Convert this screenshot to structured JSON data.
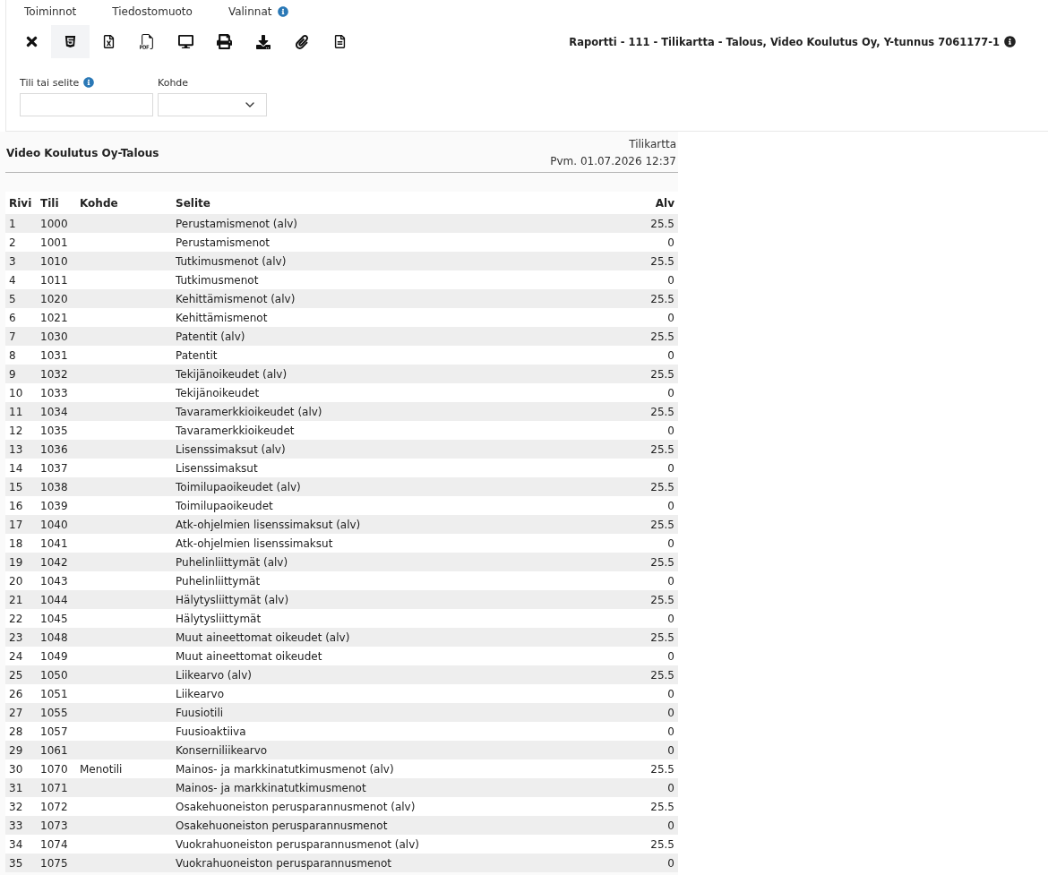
{
  "menu": [
    {
      "label": "Toiminnot",
      "info": false
    },
    {
      "label": "Tiedostomuoto",
      "info": false
    },
    {
      "label": "Valinnat",
      "info": true
    }
  ],
  "toolbar": {
    "buttons": [
      {
        "kind": "close",
        "selected": false
      },
      {
        "kind": "html",
        "selected": true
      },
      {
        "kind": "excel",
        "selected": false
      },
      {
        "kind": "pdf",
        "selected": false
      },
      {
        "kind": "screen",
        "selected": false
      },
      {
        "kind": "print",
        "selected": false
      },
      {
        "kind": "download",
        "selected": false
      },
      {
        "kind": "attach",
        "selected": false
      },
      {
        "kind": "document",
        "selected": false
      }
    ],
    "report_title": {
      "text": "Raportti - 111 - Tilikartta - Talous, Video Koulutus Oy, Y-tunnus 7061177-1",
      "info": true
    }
  },
  "filters": [
    {
      "kind": "text",
      "label": "Tili tai selite",
      "info": true
    },
    {
      "kind": "select",
      "label": "Kohde",
      "info": false
    }
  ],
  "report": {
    "company": "Video Koulutus Oy-Talous",
    "name": "Tilikartta",
    "date": "Pvm. 01.07.2026 12:37"
  },
  "table": {
    "columns": [
      "Rivi",
      "Tili",
      "Kohde",
      "Selite",
      "Alv"
    ],
    "rows": [
      {
        "rivi": "1",
        "tili": "1000",
        "selite": "Perustamismenot (alv)",
        "alv": "25.5"
      },
      {
        "rivi": "2",
        "tili": "1001",
        "selite": "Perustamismenot",
        "alv": "0"
      },
      {
        "rivi": "3",
        "tili": "1010",
        "selite": "Tutkimusmenot (alv)",
        "alv": "25.5"
      },
      {
        "rivi": "4",
        "tili": "1011",
        "selite": "Tutkimusmenot",
        "alv": "0"
      },
      {
        "rivi": "5",
        "tili": "1020",
        "selite": "Kehittämismenot (alv)",
        "alv": "25.5"
      },
      {
        "rivi": "6",
        "tili": "1021",
        "selite": "Kehittämismenot",
        "alv": "0"
      },
      {
        "rivi": "7",
        "tili": "1030",
        "selite": "Patentit (alv)",
        "alv": "25.5"
      },
      {
        "rivi": "8",
        "tili": "1031",
        "selite": "Patentit",
        "alv": "0"
      },
      {
        "rivi": "9",
        "tili": "1032",
        "selite": "Tekijänoikeudet (alv)",
        "alv": "25.5"
      },
      {
        "rivi": "10",
        "tili": "1033",
        "selite": "Tekijänoikeudet",
        "alv": "0"
      },
      {
        "rivi": "11",
        "tili": "1034",
        "selite": "Tavaramerkkioikeudet (alv)",
        "alv": "25.5"
      },
      {
        "rivi": "12",
        "tili": "1035",
        "selite": "Tavaramerkkioikeudet",
        "alv": "0"
      },
      {
        "rivi": "13",
        "tili": "1036",
        "selite": "Lisenssimaksut (alv)",
        "alv": "25.5"
      },
      {
        "rivi": "14",
        "tili": "1037",
        "selite": "Lisenssimaksut",
        "alv": "0"
      },
      {
        "rivi": "15",
        "tili": "1038",
        "selite": "Toimilupaoikeudet (alv)",
        "alv": "25.5"
      },
      {
        "rivi": "16",
        "tili": "1039",
        "selite": "Toimilupaoikeudet",
        "alv": "0"
      },
      {
        "rivi": "17",
        "tili": "1040",
        "selite": "Atk-ohjelmien lisenssimaksut (alv)",
        "alv": "25.5"
      },
      {
        "rivi": "18",
        "tili": "1041",
        "selite": "Atk-ohjelmien lisenssimaksut",
        "alv": "0"
      },
      {
        "rivi": "19",
        "tili": "1042",
        "selite": "Puhelinliittymät (alv)",
        "alv": "25.5"
      },
      {
        "rivi": "20",
        "tili": "1043",
        "selite": "Puhelinliittymät",
        "alv": "0"
      },
      {
        "rivi": "21",
        "tili": "1044",
        "selite": "Hälytysliittymät (alv)",
        "alv": "25.5"
      },
      {
        "rivi": "22",
        "tili": "1045",
        "selite": "Hälytysliittymät",
        "alv": "0"
      },
      {
        "rivi": "23",
        "tili": "1048",
        "selite": "Muut aineettomat oikeudet (alv)",
        "alv": "25.5"
      },
      {
        "rivi": "24",
        "tili": "1049",
        "selite": "Muut aineettomat oikeudet",
        "alv": "0"
      },
      {
        "rivi": "25",
        "tili": "1050",
        "selite": "Liikearvo (alv)",
        "alv": "25.5"
      },
      {
        "rivi": "26",
        "tili": "1051",
        "selite": "Liikearvo",
        "alv": "0"
      },
      {
        "rivi": "27",
        "tili": "1055",
        "selite": "Fuusiotili",
        "alv": "0"
      },
      {
        "rivi": "28",
        "tili": "1057",
        "selite": "Fuusioaktiiva",
        "alv": "0"
      },
      {
        "rivi": "29",
        "tili": "1061",
        "selite": "Konserniliikearvo",
        "alv": "0"
      },
      {
        "rivi": "30",
        "tili": "1070",
        "kohde": "Menotili",
        "selite": "Mainos- ja markkinatutkimusmenot (alv)",
        "alv": "25.5"
      },
      {
        "rivi": "31",
        "tili": "1071",
        "selite": "Mainos- ja markkinatutkimusmenot",
        "alv": "0"
      },
      {
        "rivi": "32",
        "tili": "1072",
        "selite": "Osakehuoneiston perusparannusmenot (alv)",
        "alv": "25.5"
      },
      {
        "rivi": "33",
        "tili": "1073",
        "selite": "Osakehuoneiston perusparannusmenot",
        "alv": "0"
      },
      {
        "rivi": "34",
        "tili": "1074",
        "selite": "Vuokrahuoneiston perusparannusmenot (alv)",
        "alv": "25.5"
      },
      {
        "rivi": "35",
        "tili": "1075",
        "selite": "Vuokrahuoneiston perusparannusmenot",
        "alv": "0"
      }
    ]
  }
}
